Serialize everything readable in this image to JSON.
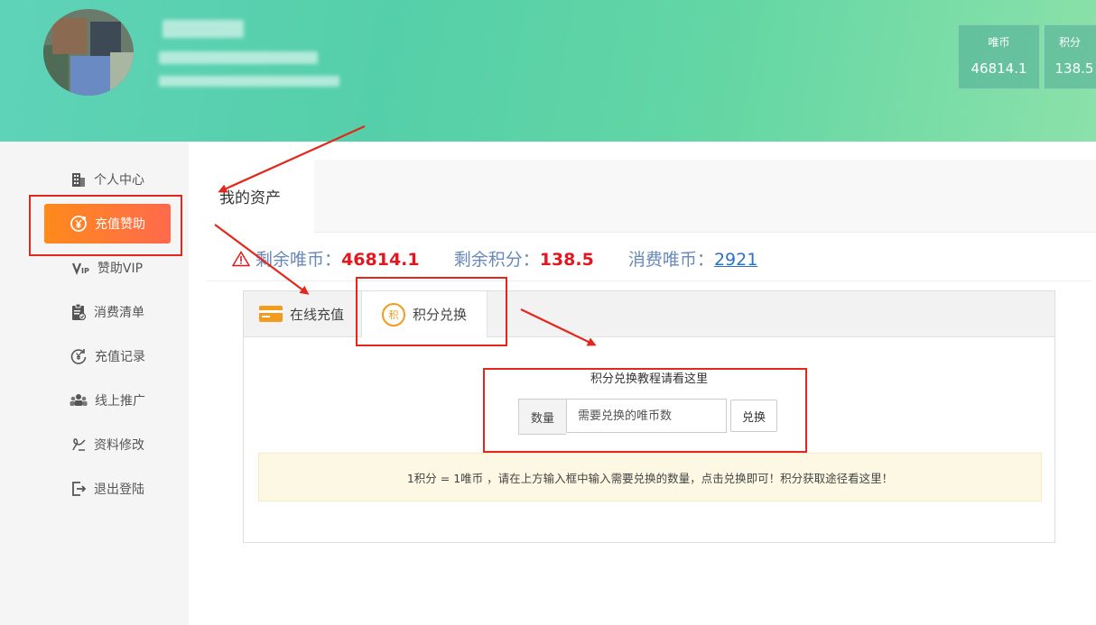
{
  "header": {
    "stats": [
      {
        "label": "唯币",
        "value": "46814.1"
      },
      {
        "label": "积分",
        "value": "138.5"
      }
    ]
  },
  "sidebar": {
    "items": [
      {
        "label": "个人中心",
        "icon": "building-icon"
      },
      {
        "label": "充值赞助",
        "icon": "yen-coin-icon",
        "active": true
      },
      {
        "label": "赞助VIP",
        "icon": "vip-icon"
      },
      {
        "label": "消费清单",
        "icon": "clipboard-icon"
      },
      {
        "label": "充值记录",
        "icon": "yen-refresh-icon"
      },
      {
        "label": "线上推广",
        "icon": "users-icon"
      },
      {
        "label": "资料修改",
        "icon": "edit-icon"
      },
      {
        "label": "退出登陆",
        "icon": "logout-icon"
      }
    ]
  },
  "main": {
    "tab_label": "我的资产",
    "assets": {
      "remaining_coins_label": "剩余唯币：",
      "remaining_coins_value": "46814.1",
      "remaining_points_label": "剩余积分：",
      "remaining_points_value": "138.5",
      "consumed_coins_label": "消费唯币：",
      "consumed_coins_value": "2921"
    },
    "panel": {
      "tabs": [
        {
          "label": "在线充值"
        },
        {
          "label": "积分兑换",
          "active": true
        }
      ],
      "points_icon_char": "积",
      "tutorial": "积分兑换教程请看这里",
      "quantity_label": "数量",
      "input_placeholder": "需要兑换的唯币数",
      "exchange_button": "兑换",
      "notice": "1积分 = 1唯币 ，请在上方输入框中输入需要兑换的数量，点击兑换即可！积分获取途径看这里！"
    }
  },
  "colors": {
    "header_gradient_start": "#5fd3b8",
    "header_gradient_end": "#8be1a9",
    "active_nav_start": "#ff8a1a",
    "active_nav_end": "#ff6a4d",
    "value_red": "#e4161e",
    "link_blue": "#2a72c6",
    "annotation_red": "#e5261d"
  }
}
